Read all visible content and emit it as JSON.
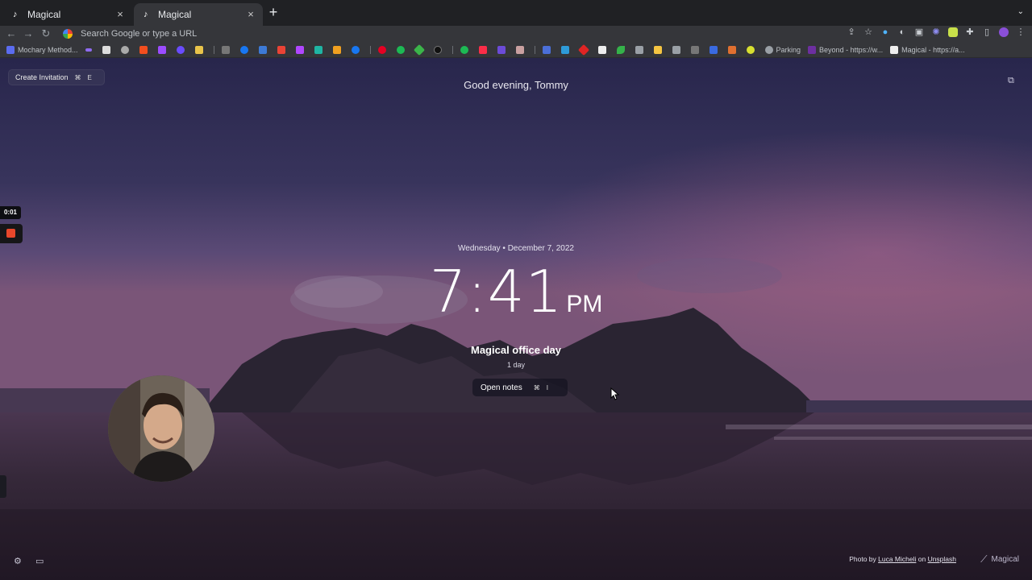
{
  "browser": {
    "tabs": [
      {
        "title": "Magical",
        "active": false
      },
      {
        "title": "Magical",
        "active": true
      }
    ],
    "omnibox_placeholder": "Search Google or type a URL",
    "bookmarks": {
      "first": "Mochary Method...",
      "parking": "Parking",
      "beyond": "Beyond - https://w...",
      "magical": "Magical - https://a..."
    }
  },
  "page": {
    "create_invitation": {
      "label": "Create Invitation",
      "shortcut_mod": "⌘",
      "shortcut_key": "E"
    },
    "greeting": "Good evening, Tommy",
    "date": "Wednesday • December 7, 2022",
    "time": "7:41",
    "ampm": "PM",
    "event_title": "Magical office day",
    "event_duration": "1 day",
    "open_notes": {
      "label": "Open notes",
      "shortcut_mod": "⌘",
      "shortcut_key": "I"
    },
    "recording_time": "0:01",
    "credit": {
      "prefix": "Photo by ",
      "author": "Luca Micheli",
      "middle": " on ",
      "source": "Unsplash"
    },
    "brand": "Magical"
  }
}
